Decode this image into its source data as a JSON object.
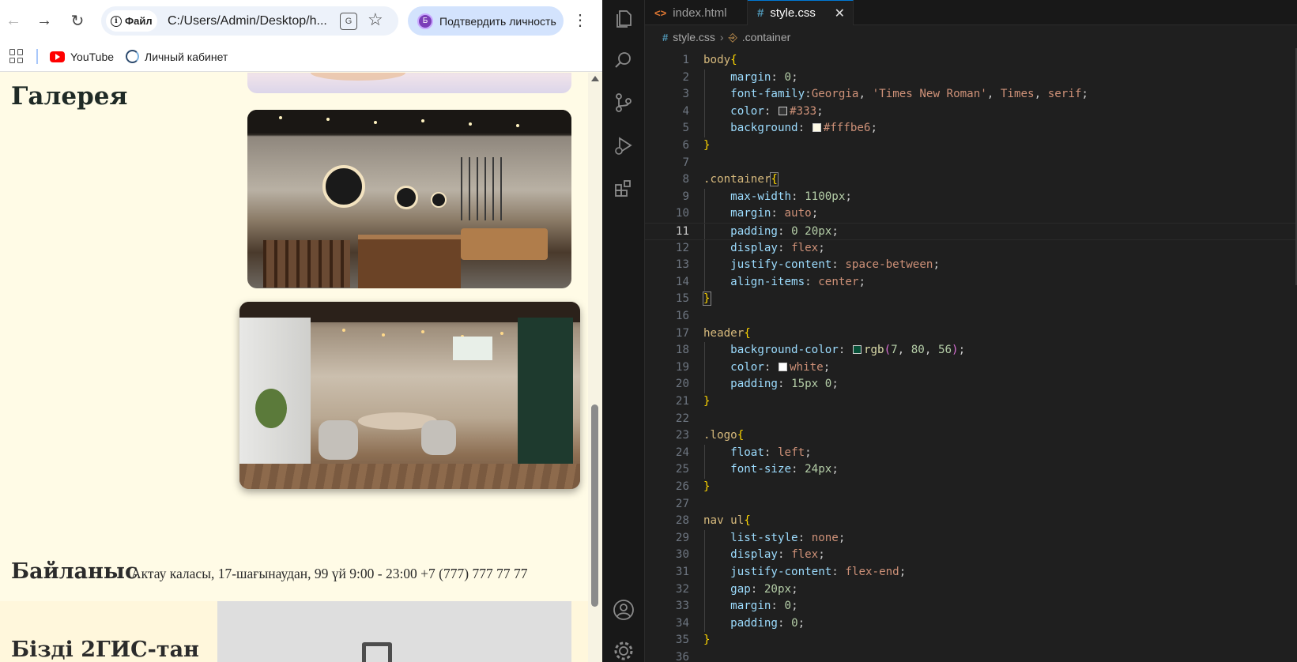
{
  "browser": {
    "nav": {
      "back_icon": "arrow-left-icon",
      "forward_icon": "arrow-right-icon",
      "reload_icon": "reload-icon"
    },
    "address_bar": {
      "site_info_label": "Файл",
      "url": "C:/Users/Admin/Desktop/h..."
    },
    "profile_button": {
      "avatar_letter": "Б",
      "label": "Подтвердить личность"
    },
    "bookmarks": [
      {
        "label": "YouTube",
        "icon": "youtube-icon"
      },
      {
        "label": "Личный кабинет",
        "icon": "cabinet-icon"
      }
    ],
    "page": {
      "gallery_title": "Галерея",
      "contact_title": "Байланыс",
      "contact_text": "Актау каласы, 17-шағынаудан, 99 үй 9:00 - 23:00 +7 (777) 777 77 77",
      "map_title": "Бізді 2ГИС-тан"
    }
  },
  "vscode": {
    "tabs": [
      {
        "label": "index.html",
        "icon": "html-file-icon",
        "active": false
      },
      {
        "label": "style.css",
        "icon": "css-file-icon",
        "active": true
      }
    ],
    "breadcrumb": {
      "file": "style.css",
      "symbol": ".container"
    },
    "current_line": 11,
    "colors": {
      "accent": "#0078d4",
      "swatch_333": "#333333",
      "swatch_fffbe6": "#fffbe6",
      "swatch_rgb": "#075038",
      "swatch_white": "#ffffff"
    },
    "lines": [
      "body{",
      "    margin: 0;",
      "    font-family:Georgia, 'Times New Roman', Times, serif;",
      "    color: #333;",
      "    background: #fffbe6;",
      "}",
      "",
      ".container{",
      "    max-width: 1100px;",
      "    margin: auto;",
      "    padding: 0 20px;",
      "    display: flex;",
      "    justify-content: space-between;",
      "    align-items: center;",
      "}",
      "",
      "header{",
      "    background-color: rgb(7, 80, 56);",
      "    color: white;",
      "    padding: 15px 0;",
      "}",
      "",
      ".logo{",
      "    float: left;",
      "    font-size: 24px;",
      "}",
      "",
      "nav ul{",
      "    list-style: none;",
      "    display: flex;",
      "    justify-content: flex-end;",
      "    gap: 20px;",
      "    margin: 0;",
      "    padding: 0;",
      "}",
      ""
    ]
  }
}
